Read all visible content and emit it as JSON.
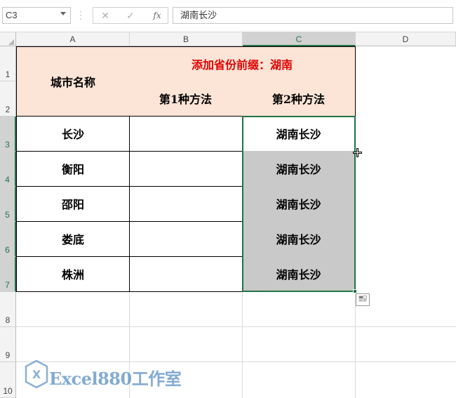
{
  "formula_bar": {
    "name_box": "C3",
    "cancel_icon": "✕",
    "enter_icon": "✓",
    "fx_label": "fx",
    "formula_value": "湖南长沙"
  },
  "columns": [
    "A",
    "B",
    "C",
    "D"
  ],
  "rows": [
    "1",
    "2",
    "3",
    "4",
    "5",
    "6",
    "7",
    "8",
    "9",
    "10"
  ],
  "selected_column": "C",
  "selected_rows": [
    "3",
    "4",
    "5",
    "6",
    "7"
  ],
  "table": {
    "city_header": "城市名称",
    "merged_header": "添加省份前缀：湖南",
    "method1": "第1种方法",
    "method2": "第2种方法",
    "cities": [
      "长沙",
      "衡阳",
      "邵阳",
      "娄底",
      "株洲"
    ],
    "method2_values": [
      "湖南长沙",
      "湖南长沙",
      "湖南长沙",
      "湖南长沙",
      "湖南长沙"
    ]
  },
  "watermark": {
    "logo_text": "X",
    "text": "Excel880工作室"
  },
  "colors": {
    "header_fill": "#fce4d6",
    "selection_green": "#217346",
    "filled_gray": "#c9c9c9",
    "title_red": "#e00000"
  }
}
